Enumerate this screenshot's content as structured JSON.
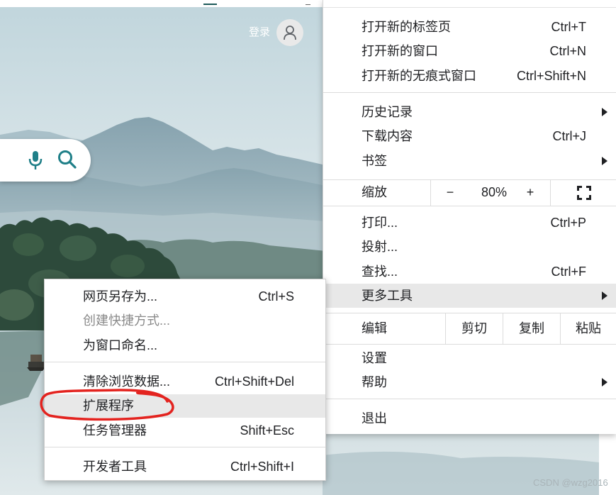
{
  "header": {
    "login_label": "登录",
    "avatar_icon": "user-icon"
  },
  "search_box": {
    "mic_icon": "microphone-icon",
    "search_icon": "search-icon"
  },
  "main_menu": {
    "new_tab": {
      "label": "打开新的标签页",
      "shortcut": "Ctrl+T"
    },
    "new_window": {
      "label": "打开新的窗口",
      "shortcut": "Ctrl+N"
    },
    "new_incognito_window": {
      "label": "打开新的无痕式窗口",
      "shortcut": "Ctrl+Shift+N"
    },
    "history": {
      "label": "历史记录",
      "icon": "chevron-right-icon"
    },
    "downloads": {
      "label": "下载内容",
      "shortcut": "Ctrl+J"
    },
    "bookmarks": {
      "label": "书签",
      "icon": "chevron-right-icon"
    },
    "zoom": {
      "label": "缩放",
      "minus": "−",
      "value": "80%",
      "plus": "+",
      "fullscreen_icon": "fullscreen-icon"
    },
    "print": {
      "label": "打印...",
      "shortcut": "Ctrl+P"
    },
    "cast": {
      "label": "投射..."
    },
    "find": {
      "label": "查找...",
      "shortcut": "Ctrl+F"
    },
    "more_tools": {
      "label": "更多工具",
      "icon": "chevron-right-icon",
      "highlighted": true
    },
    "edit": {
      "label": "编辑",
      "cut": "剪切",
      "copy": "复制",
      "paste": "粘贴"
    },
    "settings": {
      "label": "设置"
    },
    "help": {
      "label": "帮助",
      "icon": "chevron-right-icon"
    },
    "exit": {
      "label": "退出"
    }
  },
  "more_tools_submenu": {
    "items": [
      {
        "label": "网页另存为...",
        "shortcut": "Ctrl+S"
      },
      {
        "label": "创建快捷方式...",
        "disabled": true
      },
      {
        "label": "为窗口命名..."
      },
      {
        "label": "清除浏览数据...",
        "shortcut": "Ctrl+Shift+Del"
      },
      {
        "label": "扩展程序",
        "highlighted": true,
        "annotated": true
      },
      {
        "label": "任务管理器",
        "shortcut": "Shift+Esc"
      },
      {
        "label": "开发者工具",
        "shortcut": "Ctrl+Shift+I"
      }
    ]
  },
  "page": {
    "watermark": "CSDN @wzg2016"
  },
  "colors": {
    "accent_teal": "#1f7f88",
    "menu_text": "#202124",
    "disabled_text": "#8a8a8a",
    "highlight_bg": "#e8e8e8",
    "annotation_red": "#e3231f"
  }
}
